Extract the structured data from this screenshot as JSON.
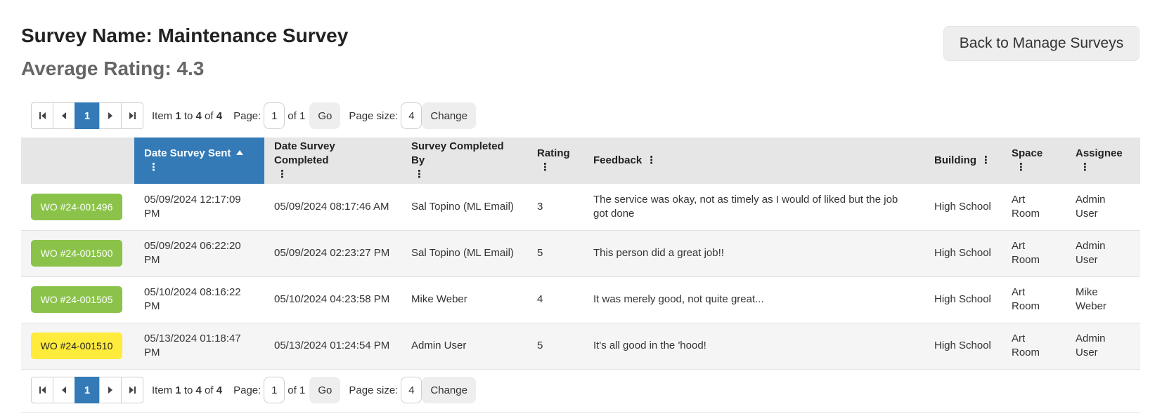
{
  "header": {
    "survey_name": "Survey Name: Maintenance Survey",
    "average_rating": "Average Rating: 4.3",
    "back_button": "Back to Manage Surveys"
  },
  "pager": {
    "current_page": "1",
    "item_prefix": "Item ",
    "item_from": "1",
    "item_to_word": " to ",
    "item_to": "4",
    "item_of_word": " of ",
    "item_total": "4",
    "page_label": "Page:",
    "page_value": "1",
    "of_pages": "of 1",
    "go_label": "Go",
    "page_size_label": "Page size:",
    "page_size_value": "4",
    "change_label": "Change"
  },
  "table": {
    "columns": [
      {
        "label": ""
      },
      {
        "label": "Date Survey Sent"
      },
      {
        "label": "Date Survey Completed"
      },
      {
        "label": "Survey Completed By"
      },
      {
        "label": "Rating"
      },
      {
        "label": "Feedback"
      },
      {
        "label": "Building"
      },
      {
        "label": "Space"
      },
      {
        "label": "Assignee"
      }
    ],
    "menu_glyph": "⋮",
    "rows": [
      {
        "wo": "WO #24-001496",
        "sent": "05/09/2024 12:17:09 PM",
        "completed": "05/09/2024 08:17:46 AM",
        "by": "Sal Topino (ML Email)",
        "rating": "3",
        "feedback": "The service was okay, not as timely as I would of liked but the job got done",
        "building": "High School",
        "space": "Art Room",
        "assignee": "Admin User"
      },
      {
        "wo": "WO #24-001500",
        "sent": "05/09/2024 06:22:20 PM",
        "completed": "05/09/2024 02:23:27 PM",
        "by": "Sal Topino (ML Email)",
        "rating": "5",
        "feedback": "This person did a great job!!",
        "building": "High School",
        "space": "Art Room",
        "assignee": "Admin User"
      },
      {
        "wo": "WO #24-001505",
        "sent": "05/10/2024 08:16:22 PM",
        "completed": "05/10/2024 04:23:58 PM",
        "by": "Mike Weber",
        "rating": "4",
        "feedback": "It was merely good, not quite great...",
        "building": "High School",
        "space": "Art Room",
        "assignee": "Mike Weber"
      },
      {
        "wo": "WO #24-001510",
        "sent": "05/13/2024 01:18:47 PM",
        "completed": "05/13/2024 01:24:54 PM",
        "by": "Admin User",
        "rating": "5",
        "feedback": "It's all good in the 'hood!",
        "building": "High School",
        "space": "Art Room",
        "assignee": "Admin User"
      }
    ]
  },
  "colors": {
    "accent": "#337ab7",
    "wo_green": "#8bc34a",
    "wo_yellow": "#ffeb3b"
  }
}
